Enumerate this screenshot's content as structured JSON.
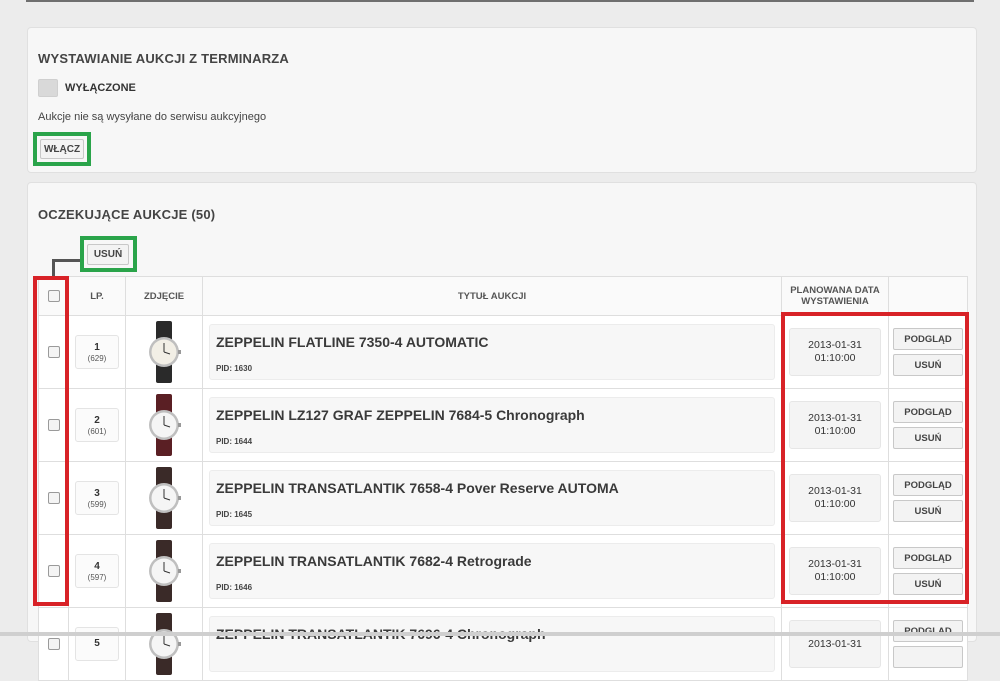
{
  "panel1": {
    "title": "WYSTAWIANIE AUKCJI Z TERMINARZA",
    "status_label": "WYŁĄCZONE",
    "description": "Aukcje nie są wysyłane do serwisu aukcyjnego",
    "enable_button": "WŁĄCZ"
  },
  "panel2": {
    "title": "OCZEKUJĄCE AUKCJE (50)",
    "delete_button": "USUŃ",
    "headers": {
      "lp": "LP.",
      "photo": "ZDJĘCIE",
      "title": "TYTUŁ AUKCJI",
      "date_line1": "PLANOWANA DATA",
      "date_line2": "WYSTAWIENIA"
    },
    "rows": [
      {
        "num": "1",
        "id": "(629)",
        "title": "ZEPPELIN FLATLINE 7350-4 AUTOMATIC",
        "pid": "PID: 1630",
        "date": "2013-01-31",
        "time": "01:10:00",
        "preview": "PODGLĄD",
        "delete": "USUŃ"
      },
      {
        "num": "2",
        "id": "(601)",
        "title": "ZEPPELIN LZ127 GRAF ZEPPELIN 7684-5 Chronograph",
        "pid": "PID: 1644",
        "date": "2013-01-31",
        "time": "01:10:00",
        "preview": "PODGLĄD",
        "delete": "USUŃ"
      },
      {
        "num": "3",
        "id": "(599)",
        "title": "ZEPPELIN TRANSATLANTIK 7658-4 Pover Reserve AUTOMA",
        "pid": "PID: 1645",
        "date": "2013-01-31",
        "time": "01:10:00",
        "preview": "PODGLĄD",
        "delete": "USUŃ"
      },
      {
        "num": "4",
        "id": "(597)",
        "title": "ZEPPELIN TRANSATLANTIK 7682-4 Retrograde",
        "pid": "PID: 1646",
        "date": "2013-01-31",
        "time": "01:10:00",
        "preview": "PODGLĄD",
        "delete": "USUŃ"
      },
      {
        "num": "5",
        "id": "",
        "title": "ZEPPELIN TRANSATLANTIK 7696-4 Chronograph",
        "pid": "",
        "date": "2013-01-31",
        "time": "",
        "preview": "PODGLĄD",
        "delete": ""
      }
    ]
  },
  "colors": {
    "highlight_green": "#2aa44a",
    "highlight_red": "#d82227",
    "page_bg": "#ececec"
  },
  "icons": {
    "watch_thumbnail": "watch-icon",
    "checkbox": "checkbox-icon"
  }
}
